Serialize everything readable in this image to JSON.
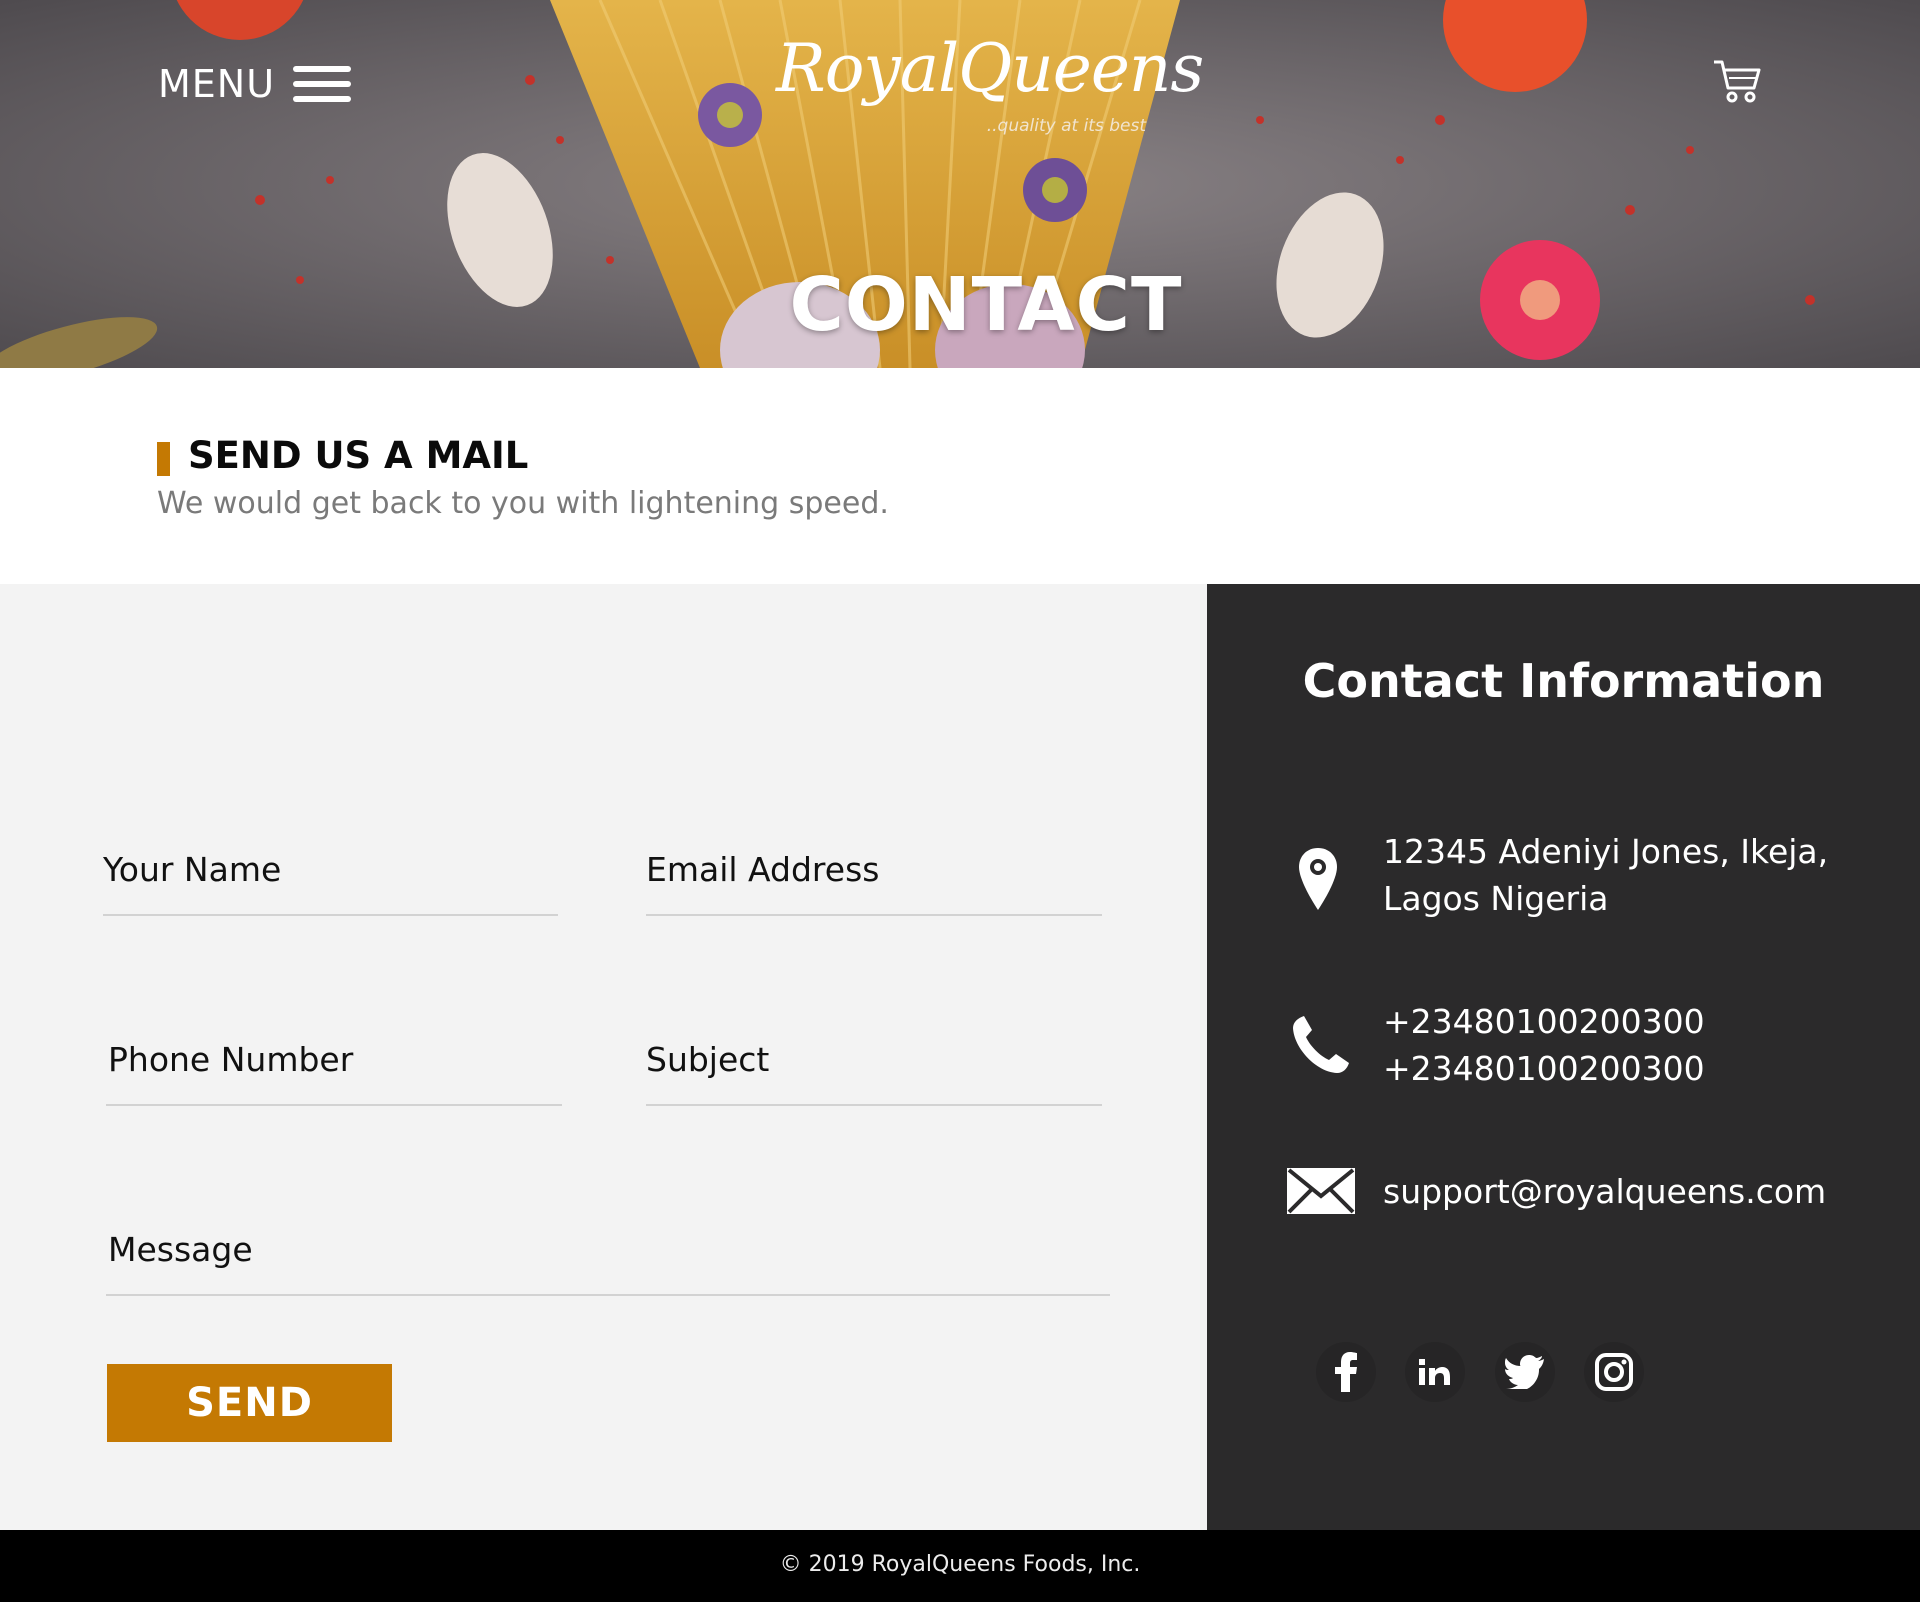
{
  "header": {
    "menu_label": "MENU",
    "logo_text": "RoyalQueens",
    "logo_tagline": "..quality at its best",
    "hero_title": "CONTACT"
  },
  "intro": {
    "title": "SEND US A MAIL",
    "subtitle": "We would get back to you with lightening speed."
  },
  "form": {
    "fields": {
      "name": "Your Name",
      "email": "Email Address",
      "phone": "Phone Number",
      "subject": "Subject",
      "message": "Message"
    },
    "send_label": "SEND"
  },
  "contact_info": {
    "title": "Contact Information",
    "address_line1": "12345 Adeniyi Jones, Ikeja,",
    "address_line2": "Lagos Nigeria",
    "phone_1": "+23480100200300",
    "phone_2": "+23480100200300",
    "email": "support@royalqueens.com",
    "social": [
      "facebook-icon",
      "linkedin-icon",
      "twitter-icon",
      "instagram-icon"
    ]
  },
  "footer": {
    "copyright": "© 2019 RoyalQueens Foods, Inc."
  },
  "colors": {
    "accent": "#c47903",
    "dark_panel": "#2b2a2b",
    "form_bg": "#f3f3f3",
    "footer_bg": "#000000"
  }
}
